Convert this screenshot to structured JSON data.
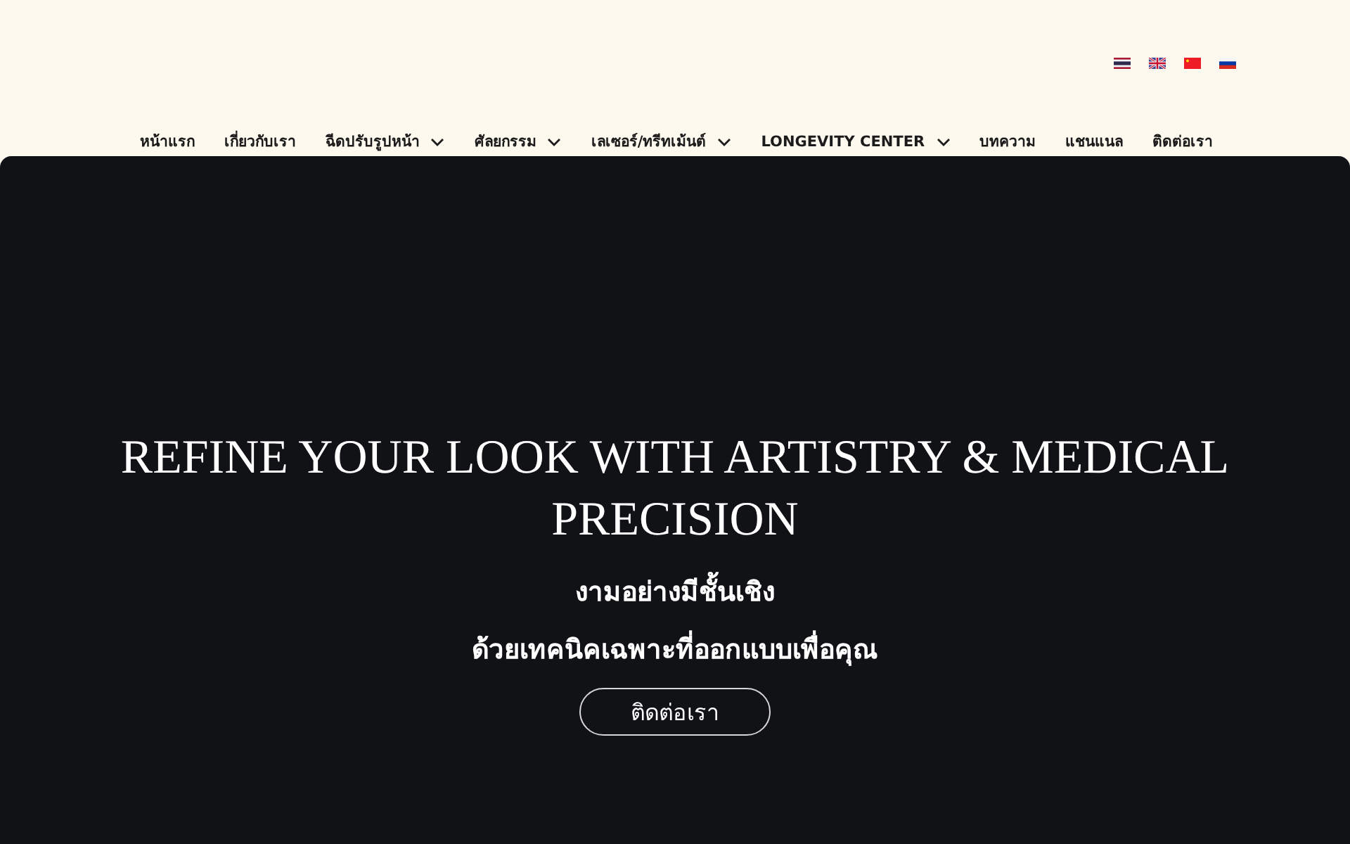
{
  "header": {
    "language_flags": [
      {
        "kind": "th"
      },
      {
        "kind": "gb"
      },
      {
        "kind": "cn"
      },
      {
        "kind": "ru"
      }
    ],
    "nav": [
      {
        "label": "หน้าแรก",
        "dropdown": false
      },
      {
        "label": "เกี่ยวกับเรา",
        "dropdown": false
      },
      {
        "label": "ฉีดปรับรูปหน้า",
        "dropdown": true
      },
      {
        "label": "ศัลยกรรม",
        "dropdown": true
      },
      {
        "label": "เลเซอร์/ทรีทเม้นต์",
        "dropdown": true
      },
      {
        "label": "LONGEVITY CENTER",
        "dropdown": true
      },
      {
        "label": "บทความ",
        "dropdown": false
      },
      {
        "label": "แชนแนล",
        "dropdown": false
      },
      {
        "label": "ติดต่อเรา",
        "dropdown": false
      }
    ]
  },
  "hero": {
    "title": "REFINE YOUR LOOK WITH ARTISTRY & MEDICAL PRECISION",
    "subtitle_lines": [
      "งามอย่างมีชั้นเชิง",
      "ด้วยเทคนิคเฉพาะที่ออกแบบเพื่อคุณ"
    ],
    "button": "ติดต่อเรา"
  }
}
